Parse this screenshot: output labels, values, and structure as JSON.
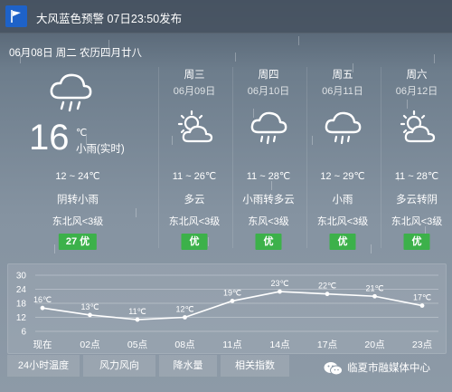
{
  "alert": {
    "text": "大风蓝色预警 07日23:50发布"
  },
  "today": {
    "date_line": "06月08日 周二 农历四月廿八",
    "temp": "16",
    "unit": "℃",
    "condition": "小雨(实时)",
    "icon": "rain-cloud-icon",
    "temp_range": "12 ~ 24℃",
    "weather": "阴转小雨",
    "wind": "东北风<3级",
    "aqi": "27  优"
  },
  "forecast": [
    {
      "day": "周三",
      "date": "06月09日",
      "icon": "partly-cloudy-icon",
      "temp_range": "11 ~ 26℃",
      "weather": "多云",
      "wind": "东北风<3级",
      "aqi": "优"
    },
    {
      "day": "周四",
      "date": "06月10日",
      "icon": "rain-cloud-icon",
      "temp_range": "11 ~ 28℃",
      "weather": "小雨转多云",
      "wind": "东风<3级",
      "aqi": "优"
    },
    {
      "day": "周五",
      "date": "06月11日",
      "icon": "rain-cloud-icon",
      "temp_range": "12 ~ 29℃",
      "weather": "小雨",
      "wind": "东北风<3级",
      "aqi": "优"
    },
    {
      "day": "周六",
      "date": "06月12日",
      "icon": "partly-cloudy-icon",
      "temp_range": "11 ~ 28℃",
      "weather": "多云转阴",
      "wind": "东北风<3级",
      "aqi": "优"
    }
  ],
  "chart_data": {
    "type": "line",
    "x": [
      "现在",
      "02点",
      "05点",
      "08点",
      "11点",
      "14点",
      "17点",
      "20点",
      "23点"
    ],
    "values": [
      16,
      13,
      11,
      12,
      19,
      23,
      22,
      21,
      17
    ],
    "data_labels": [
      "16℃",
      "13℃",
      "11℃",
      "12℃",
      "19℃",
      "23℃",
      "22℃",
      "21℃",
      "17℃"
    ],
    "y_ticks": [
      30,
      24,
      18,
      12,
      6
    ],
    "ylim": [
      6,
      30
    ],
    "grid": true
  },
  "tabs": [
    "24小时温度",
    "风力风向",
    "降水量",
    "相关指数"
  ],
  "watermark": {
    "text": "临夏市融媒体中心",
    "icon": "wechat-icon"
  },
  "colors": {
    "aqi_good": "#3cb14a",
    "alert_blue": "#1e62c8"
  }
}
